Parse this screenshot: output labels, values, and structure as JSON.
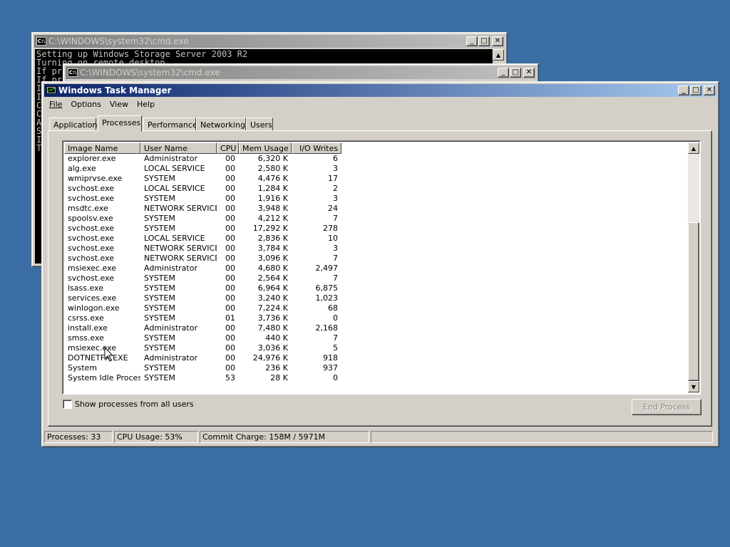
{
  "background_color": "#3a6ea5",
  "cmd_back": {
    "title": "C:\\WINDOWS\\system32\\cmd.exe",
    "icon": "cmd-icon",
    "lines": [
      "Setting up Windows Storage Server 2003 R2",
      "Turning on remote desktop",
      "If pr",
      "If pr",
      "I",
      "I",
      "C",
      "C",
      "A",
      "S",
      "I",
      "T"
    ]
  },
  "cmd_front": {
    "title": "C:\\WINDOWS\\system32\\cmd.exe",
    "icon": "cmd-icon"
  },
  "taskmgr": {
    "title": "Windows Task Manager",
    "menu": [
      "File",
      "Options",
      "View",
      "Help"
    ],
    "tabs": [
      "Applications",
      "Processes",
      "Performance",
      "Networking",
      "Users"
    ],
    "selected_tab": "Processes",
    "columns": [
      "Image Name",
      "User Name",
      "CPU",
      "Mem Usage",
      "I/O Writes"
    ],
    "processes": [
      [
        "explorer.exe",
        "Administrator",
        "00",
        "6,320 K",
        "6"
      ],
      [
        "alg.exe",
        "LOCAL SERVICE",
        "00",
        "2,580 K",
        "3"
      ],
      [
        "wmiprvse.exe",
        "SYSTEM",
        "00",
        "4,476 K",
        "17"
      ],
      [
        "svchost.exe",
        "LOCAL SERVICE",
        "00",
        "1,284 K",
        "2"
      ],
      [
        "svchost.exe",
        "SYSTEM",
        "00",
        "1,916 K",
        "3"
      ],
      [
        "msdtc.exe",
        "NETWORK SERVICE",
        "00",
        "3,948 K",
        "24"
      ],
      [
        "spoolsv.exe",
        "SYSTEM",
        "00",
        "4,212 K",
        "7"
      ],
      [
        "svchost.exe",
        "SYSTEM",
        "00",
        "17,292 K",
        "278"
      ],
      [
        "svchost.exe",
        "LOCAL SERVICE",
        "00",
        "2,836 K",
        "10"
      ],
      [
        "svchost.exe",
        "NETWORK SERVICE",
        "00",
        "3,784 K",
        "3"
      ],
      [
        "svchost.exe",
        "NETWORK SERVICE",
        "00",
        "3,096 K",
        "7"
      ],
      [
        "msiexec.exe",
        "Administrator",
        "00",
        "4,680 K",
        "2,497"
      ],
      [
        "svchost.exe",
        "SYSTEM",
        "00",
        "2,564 K",
        "7"
      ],
      [
        "lsass.exe",
        "SYSTEM",
        "00",
        "6,964 K",
        "6,875"
      ],
      [
        "services.exe",
        "SYSTEM",
        "00",
        "3,240 K",
        "1,023"
      ],
      [
        "winlogon.exe",
        "SYSTEM",
        "00",
        "7,224 K",
        "68"
      ],
      [
        "csrss.exe",
        "SYSTEM",
        "01",
        "3,736 K",
        "0"
      ],
      [
        "install.exe",
        "Administrator",
        "00",
        "7,480 K",
        "2,168"
      ],
      [
        "smss.exe",
        "SYSTEM",
        "00",
        "440 K",
        "7"
      ],
      [
        "msiexec.exe",
        "SYSTEM",
        "00",
        "3,036 K",
        "5"
      ],
      [
        "DOTNETFX.EXE",
        "Administrator",
        "00",
        "24,976 K",
        "918"
      ],
      [
        "System",
        "SYSTEM",
        "00",
        "236 K",
        "937"
      ],
      [
        "System Idle Process",
        "SYSTEM",
        "53",
        "28 K",
        "0"
      ]
    ],
    "show_all_users_label": "Show processes from all users",
    "end_process_label": "End Process",
    "status": {
      "processes": "Processes: 33",
      "cpu": "CPU Usage: 53%",
      "commit": "Commit Charge: 158M / 5971M"
    }
  }
}
